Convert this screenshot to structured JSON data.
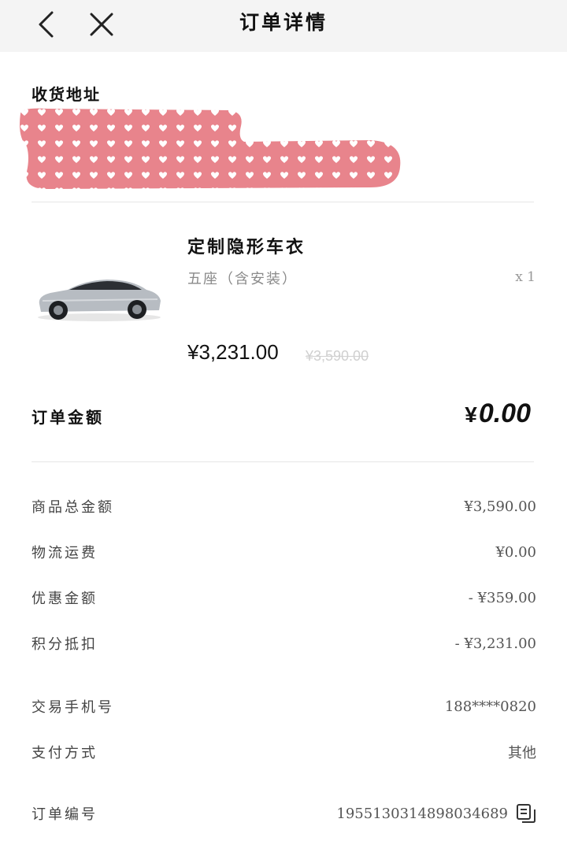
{
  "header": {
    "title": "订单详情"
  },
  "address": {
    "label": "收货地址"
  },
  "product": {
    "name": "定制隐形车衣",
    "spec": "五座（含安装）",
    "quantity": "x 1",
    "price": "¥3,231.00",
    "original_price": "¥3,590.00"
  },
  "order_total": {
    "label": "订单金额",
    "currency": "¥",
    "amount": "0.00"
  },
  "breakdown": [
    {
      "label": "商品总金额",
      "value": "¥3,590.00"
    },
    {
      "label": "物流运费",
      "value": "¥0.00"
    },
    {
      "label": "优惠金额",
      "value": "- ¥359.00"
    },
    {
      "label": "积分抵扣",
      "value": "- ¥3,231.00"
    }
  ],
  "info": [
    {
      "label": "交易手机号",
      "value": "188****0820"
    },
    {
      "label": "支付方式",
      "value": "其他"
    }
  ],
  "order_number": {
    "label": "订单编号",
    "value": "1955130314898034689"
  },
  "colors": {
    "redaction": "#e8848c",
    "header_bg": "#f4f4f4",
    "divider": "#e6e6e6"
  }
}
